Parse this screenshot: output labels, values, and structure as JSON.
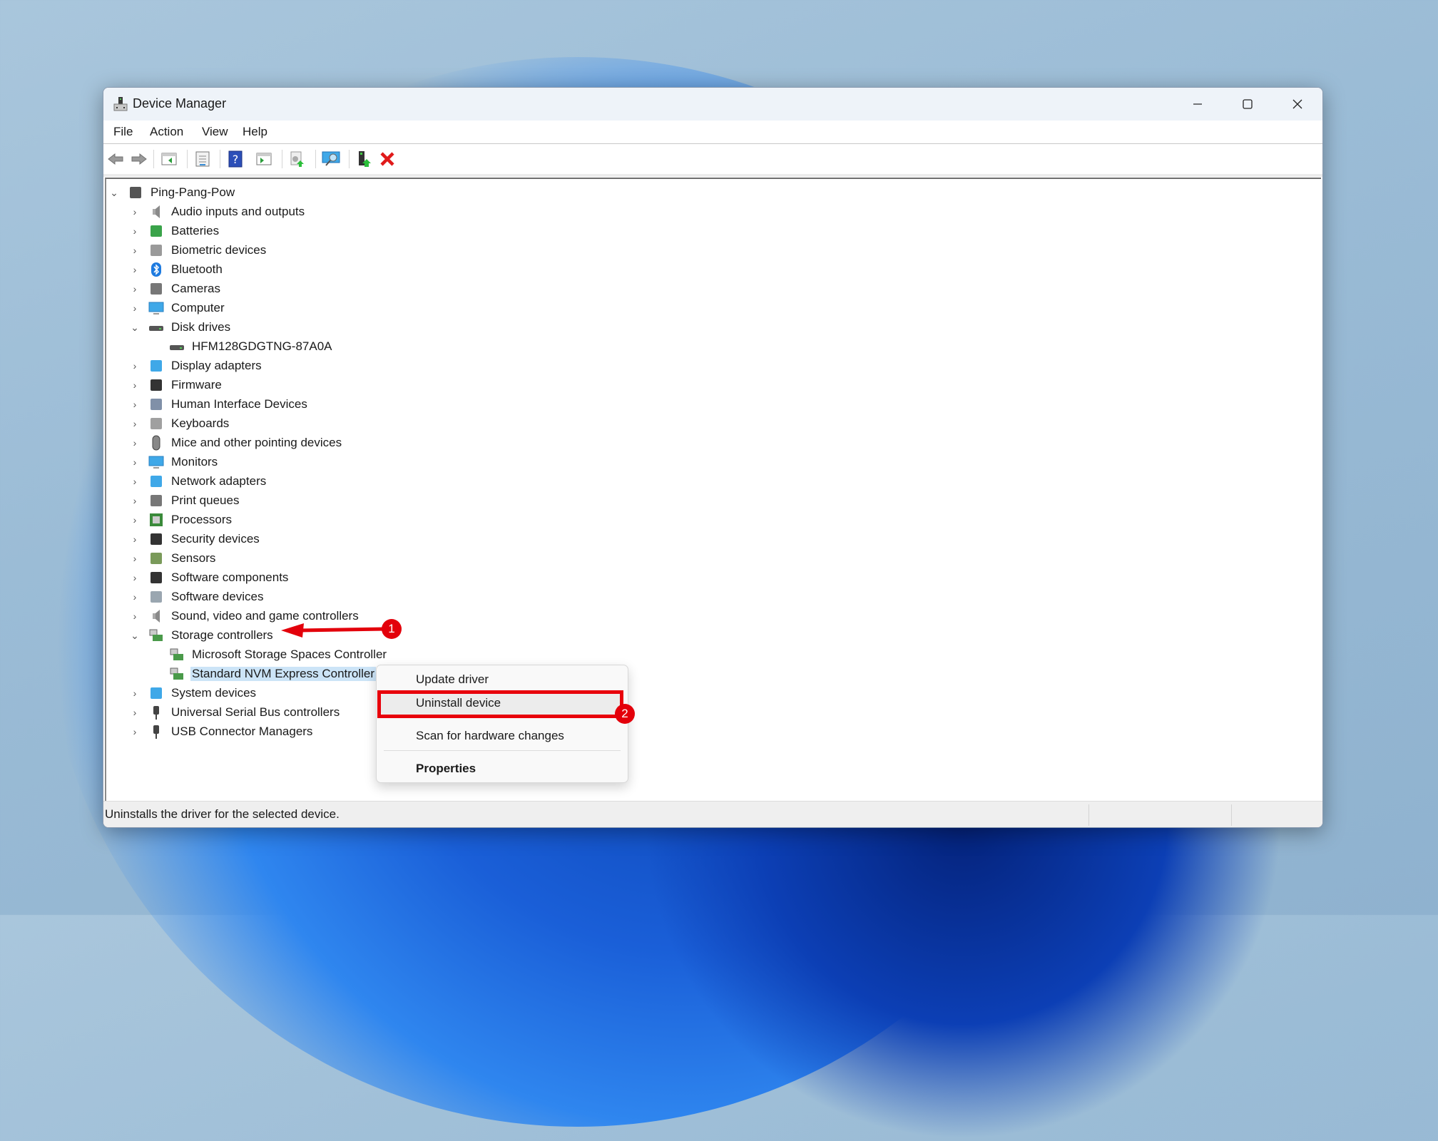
{
  "window": {
    "title": "Device Manager",
    "controls": {
      "minimize": "minimize",
      "maximize": "maximize",
      "close": "close"
    }
  },
  "menubar": [
    "File",
    "Action",
    "View",
    "Help"
  ],
  "toolbar": {
    "buttons": [
      "back-icon",
      "forward-icon",
      "show-hide-console-tree-icon",
      "properties-icon",
      "help-icon",
      "show-action-pane-icon",
      "update-driver-icon",
      "scan-hardware-icon",
      "enable-device-icon",
      "uninstall-device-icon"
    ]
  },
  "tree": {
    "root": "Ping-Pang-Pow",
    "categories": [
      {
        "label": "Audio inputs and outputs",
        "icon": "speaker-icon",
        "expanded": false
      },
      {
        "label": "Batteries",
        "icon": "battery-icon",
        "expanded": false
      },
      {
        "label": "Biometric devices",
        "icon": "fingerprint-icon",
        "expanded": false
      },
      {
        "label": "Bluetooth",
        "icon": "bluetooth-icon",
        "expanded": false
      },
      {
        "label": "Cameras",
        "icon": "camera-icon",
        "expanded": false
      },
      {
        "label": "Computer",
        "icon": "computer-icon",
        "expanded": false
      },
      {
        "label": "Disk drives",
        "icon": "disk-drive-icon",
        "expanded": true,
        "children": [
          "HFM128GDGTNG-87A0A"
        ]
      },
      {
        "label": "Display adapters",
        "icon": "display-adapter-icon",
        "expanded": false
      },
      {
        "label": "Firmware",
        "icon": "firmware-chip-icon",
        "expanded": false
      },
      {
        "label": "Human Interface Devices",
        "icon": "hid-icon",
        "expanded": false
      },
      {
        "label": "Keyboards",
        "icon": "keyboard-icon",
        "expanded": false
      },
      {
        "label": "Mice and other pointing devices",
        "icon": "mouse-icon",
        "expanded": false
      },
      {
        "label": "Monitors",
        "icon": "monitor-icon",
        "expanded": false
      },
      {
        "label": "Network adapters",
        "icon": "network-icon",
        "expanded": false
      },
      {
        "label": "Print queues",
        "icon": "printer-icon",
        "expanded": false
      },
      {
        "label": "Processors",
        "icon": "processor-icon",
        "expanded": false
      },
      {
        "label": "Security devices",
        "icon": "security-key-icon",
        "expanded": false
      },
      {
        "label": "Sensors",
        "icon": "sensor-icon",
        "expanded": false
      },
      {
        "label": "Software components",
        "icon": "software-component-icon",
        "expanded": false
      },
      {
        "label": "Software devices",
        "icon": "software-device-icon",
        "expanded": false
      },
      {
        "label": "Sound, video and game controllers",
        "icon": "speaker-icon",
        "expanded": false
      },
      {
        "label": "Storage controllers",
        "icon": "storage-controller-icon",
        "expanded": true,
        "children": [
          "Microsoft Storage Spaces Controller",
          "Standard NVM Express Controller"
        ]
      },
      {
        "label": "System devices",
        "icon": "system-devices-icon",
        "expanded": false
      },
      {
        "label": "Universal Serial Bus controllers",
        "icon": "usb-icon",
        "expanded": false
      },
      {
        "label": "USB Connector Managers",
        "icon": "usb-icon",
        "expanded": false
      }
    ],
    "selected": "Standard NVM Express Controller"
  },
  "context_menu": {
    "items": [
      "Update driver",
      "Uninstall device",
      "Scan for hardware changes",
      "Properties"
    ],
    "highlighted": "Uninstall device",
    "default": "Properties"
  },
  "annotations": {
    "step1": "1",
    "step2": "2",
    "color": "#e3000b"
  },
  "statusbar": {
    "text": "Uninstalls the driver for the selected device."
  }
}
